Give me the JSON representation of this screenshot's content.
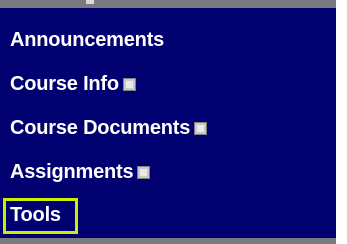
{
  "menu": {
    "items": [
      {
        "label": "Announcements",
        "has_menu_icon": false,
        "highlighted": false
      },
      {
        "label": "Course Info",
        "has_menu_icon": true,
        "highlighted": false
      },
      {
        "label": "Course Documents",
        "has_menu_icon": true,
        "highlighted": false
      },
      {
        "label": "Assignments",
        "has_menu_icon": true,
        "highlighted": false
      },
      {
        "label": "Tools",
        "has_menu_icon": false,
        "highlighted": true
      }
    ],
    "colors": {
      "background": "#000070",
      "text": "#ffffff",
      "highlight_border": "#c8f000",
      "strip": "#787a80"
    },
    "icons": {
      "item_menu_icon": "context-menu-icon"
    }
  }
}
